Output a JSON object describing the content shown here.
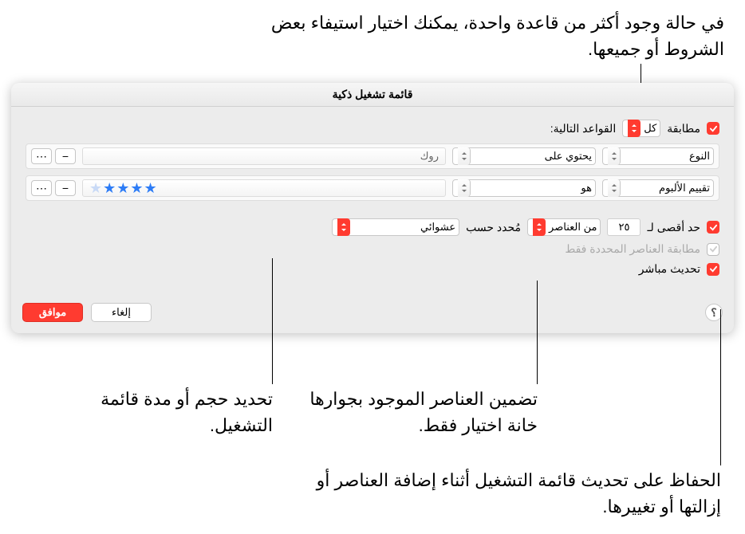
{
  "callouts": {
    "top": "في حالة وجود أكثر من قاعدة واحدة، يمكنك اختيار استيفاء بعض الشروط أو جميعها.",
    "checked_only": "تضمين العناصر الموجود بجوارها خانة اختيار فقط.",
    "size_duration": "تحديد حجم أو مدة قائمة التشغيل.",
    "live_update": "الحفاظ على تحديث قائمة التشغيل أثناء إضافة العناصر أو إزالتها أو تغييرها."
  },
  "dialog": {
    "title": "قائمة تشغيل ذكية",
    "match_label_pre": "مطابقة",
    "match_mode": "كل",
    "match_label_post": "القواعد التالية:",
    "rules": [
      {
        "field": "النوع",
        "op": "يحتوي على",
        "value": "روك"
      },
      {
        "field": "تقييم الألبوم",
        "op": "هو",
        "stars": 4
      }
    ],
    "limit": {
      "label": "حد أقصى لـ",
      "value": "٢٥",
      "unit": "من العناصر",
      "selected_by_label": "مُحدد حسب",
      "selected_by": "عشوائي"
    },
    "checked_only_label": "مطابقة العناصر المحددة فقط",
    "live_update_label": "تحديث مباشر",
    "buttons": {
      "cancel": "إلغاء",
      "ok": "موافق"
    }
  },
  "icons": {
    "minus": "−",
    "dots": "⋯",
    "help": "؟"
  }
}
